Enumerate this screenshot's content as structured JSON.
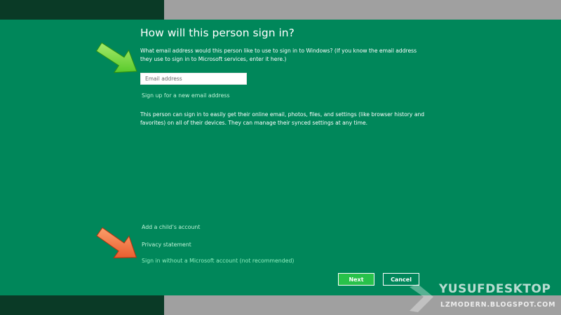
{
  "dialog": {
    "title": "How will this person sign in?",
    "description": "What email address would this person like to use to sign in to Windows? (If you know the email address they use to sign in to Microsoft services, enter it here.)",
    "email_placeholder": "Email address",
    "email_value": "",
    "signup_link": "Sign up for a new email address",
    "info": "This person can sign in to easily get their online email, photos, files, and settings (like browser history and favorites) on all of their devices. They can manage their synced settings at any time.",
    "child_link": "Add a child’s account",
    "privacy_link": "Privacy statement",
    "no_msa_link": "Sign in without a Microsoft account (not recommended)",
    "next_label": "Next",
    "cancel_label": "Cancel"
  },
  "watermark": {
    "line1": "YUSUFDESKTOP",
    "line2": "LZMODERN.BLOGSPOT.COM"
  },
  "colors": {
    "dialog_bg": "#00875a",
    "link": "#bff3d7",
    "next_button": "#28c24a",
    "green_arrow": "#4fd12b",
    "orange_arrow": "#f05a28"
  },
  "icons": [
    "green-arrow-icon",
    "orange-arrow-icon",
    "watermark-logo-icon"
  ]
}
